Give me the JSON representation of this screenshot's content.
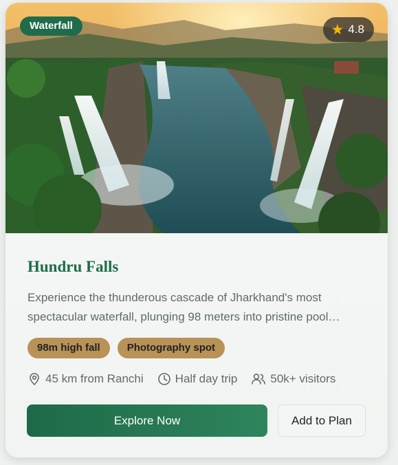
{
  "card": {
    "category_badge": "Waterfall",
    "rating": "4.8",
    "rating_icon": "star-icon",
    "title": "Hundru Falls",
    "description": "Experience the thunderous cascade of Jharkhand's most spectacular waterfall, plunging 98 meters into pristine pool…",
    "tags": [
      "98m high fall",
      "Photography spot"
    ],
    "meta": [
      {
        "icon": "location-pin-icon",
        "text": "45 km from Ranchi"
      },
      {
        "icon": "clock-icon",
        "text": "Half day trip"
      },
      {
        "icon": "users-icon",
        "text": "50k+ visitors"
      }
    ],
    "primary_button": "Explore Now",
    "secondary_button": "Add to Plan"
  },
  "colors": {
    "brand_green": "#1f6b4a",
    "tag_tan": "#b89257",
    "rating_star": "#f5b800"
  }
}
